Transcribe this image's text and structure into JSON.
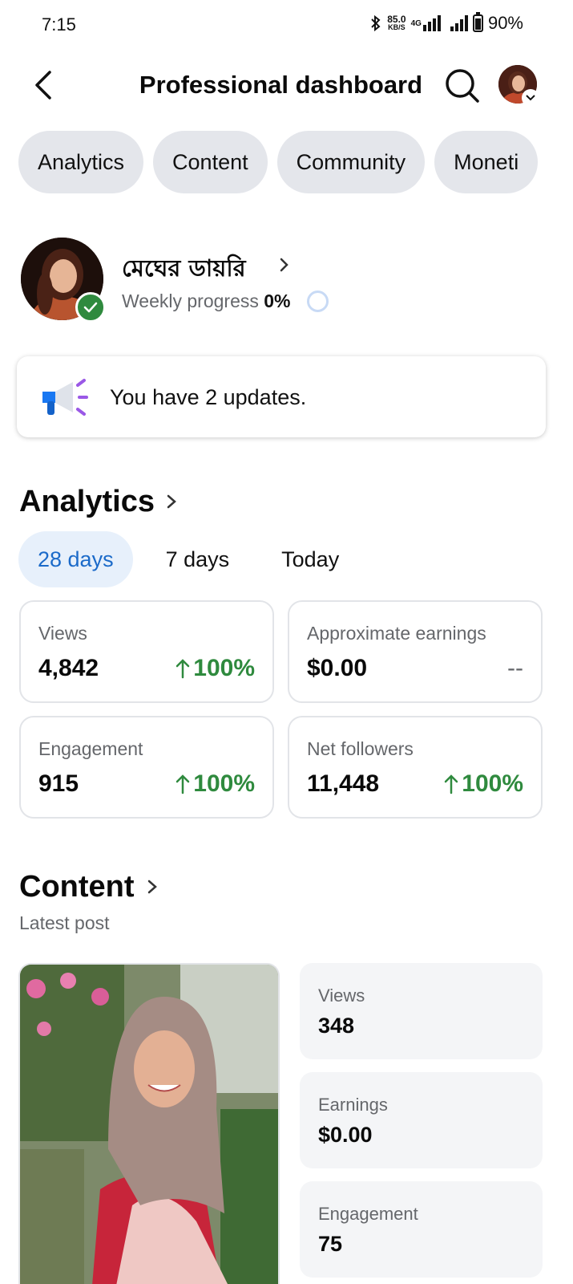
{
  "status_bar": {
    "time": "7:15",
    "speed_value": "85.0",
    "speed_unit": "KB/S",
    "network": "4G",
    "battery": "90%"
  },
  "header": {
    "title": "Professional dashboard",
    "back_icon": "back-arrow-icon",
    "search_icon": "search-icon"
  },
  "tabs": [
    "Analytics",
    "Content",
    "Community",
    "Moneti"
  ],
  "profile": {
    "name": "মেঘের ডায়রি",
    "weekly_label": "Weekly progress",
    "weekly_value": "0%",
    "weekly_progress": 0
  },
  "updates": {
    "text": "You have 2 updates.",
    "icon": "megaphone-icon"
  },
  "analytics": {
    "title": "Analytics",
    "ranges": [
      "28 days",
      "7 days",
      "Today"
    ],
    "selected_range": "28 days",
    "metrics": [
      {
        "label": "Views",
        "value": "4,842",
        "change": "100%"
      },
      {
        "label": "Approximate earnings",
        "value": "$0.00",
        "change": "--"
      },
      {
        "label": "Engagement",
        "value": "915",
        "change": "100%"
      },
      {
        "label": "Net followers",
        "value": "11,448",
        "change": "100%"
      }
    ]
  },
  "content": {
    "title": "Content",
    "subtitle": "Latest post",
    "stats": [
      {
        "label": "Views",
        "value": "348"
      },
      {
        "label": "Earnings",
        "value": "$0.00"
      },
      {
        "label": "Engagement",
        "value": "75"
      }
    ]
  },
  "colors": {
    "accent_blue": "#1b6ac9",
    "positive_green": "#2f8a3e",
    "chip_bg": "#e4e6eb"
  }
}
